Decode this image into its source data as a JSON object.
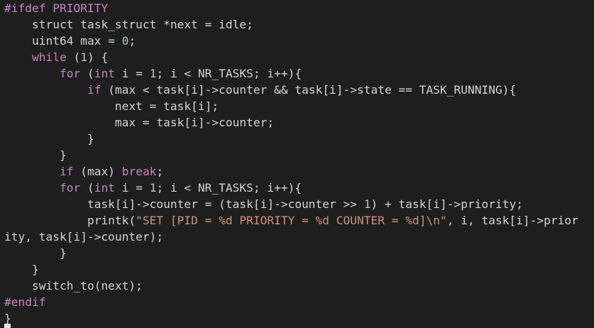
{
  "editor": {
    "theme": {
      "background": "#1e1e1e",
      "foreground": "#d4d4d4",
      "keyword": "#c586c0",
      "number": "#b5cea8",
      "string": "#ce9178"
    },
    "lines": [
      [
        {
          "t": "#ifdef PRIORITY",
          "c": "pp"
        }
      ],
      [
        {
          "t": "    struct task_struct *next = idle;",
          "c": ""
        }
      ],
      [
        {
          "t": "    uint64 max = ",
          "c": ""
        },
        {
          "t": "0",
          "c": "num"
        },
        {
          "t": ";",
          "c": ""
        }
      ],
      [
        {
          "t": "    ",
          "c": ""
        },
        {
          "t": "while",
          "c": "kw"
        },
        {
          "t": " (",
          "c": ""
        },
        {
          "t": "1",
          "c": "num"
        },
        {
          "t": ") {",
          "c": ""
        }
      ],
      [
        {
          "t": "        ",
          "c": ""
        },
        {
          "t": "for",
          "c": "kw"
        },
        {
          "t": " (",
          "c": ""
        },
        {
          "t": "int",
          "c": "kw"
        },
        {
          "t": " i = ",
          "c": ""
        },
        {
          "t": "1",
          "c": "num"
        },
        {
          "t": "; i < NR_TASKS; i++){",
          "c": ""
        }
      ],
      [
        {
          "t": "            ",
          "c": ""
        },
        {
          "t": "if",
          "c": "kw"
        },
        {
          "t": " (max < task[i]->counter && task[i]->state == TASK_RUNNING){",
          "c": ""
        }
      ],
      [
        {
          "t": "                next = task[i];",
          "c": ""
        }
      ],
      [
        {
          "t": "                max = task[i]->counter;",
          "c": ""
        }
      ],
      [
        {
          "t": "            }",
          "c": ""
        }
      ],
      [
        {
          "t": "        }",
          "c": ""
        }
      ],
      [
        {
          "t": "        ",
          "c": ""
        },
        {
          "t": "if",
          "c": "kw"
        },
        {
          "t": " (max) ",
          "c": ""
        },
        {
          "t": "break",
          "c": "kw"
        },
        {
          "t": ";",
          "c": ""
        }
      ],
      [
        {
          "t": "        ",
          "c": ""
        },
        {
          "t": "for",
          "c": "kw"
        },
        {
          "t": " (",
          "c": ""
        },
        {
          "t": "int",
          "c": "kw"
        },
        {
          "t": " i = ",
          "c": ""
        },
        {
          "t": "1",
          "c": "num"
        },
        {
          "t": "; i < NR_TASKS; i++){",
          "c": ""
        }
      ],
      [
        {
          "t": "            task[i]->counter = (task[i]->counter >> ",
          "c": ""
        },
        {
          "t": "1",
          "c": "num"
        },
        {
          "t": ") + task[i]->priority;",
          "c": ""
        }
      ],
      [
        {
          "t": "            printk(",
          "c": ""
        },
        {
          "t": "\"SET [PID = %d PRIORITY = %d COUNTER = %d]\\n\"",
          "c": "str"
        },
        {
          "t": ", i, task[i]->prior",
          "c": ""
        }
      ],
      [
        {
          "t": "ity, task[i]->counter);",
          "c": ""
        }
      ],
      [
        {
          "t": "        }",
          "c": ""
        }
      ],
      [
        {
          "t": "    }",
          "c": ""
        }
      ],
      [
        {
          "t": "    switch_to(next);",
          "c": ""
        }
      ],
      [
        {
          "t": "#endif",
          "c": "pp"
        }
      ],
      [
        {
          "t": "}",
          "c": ""
        }
      ]
    ]
  }
}
